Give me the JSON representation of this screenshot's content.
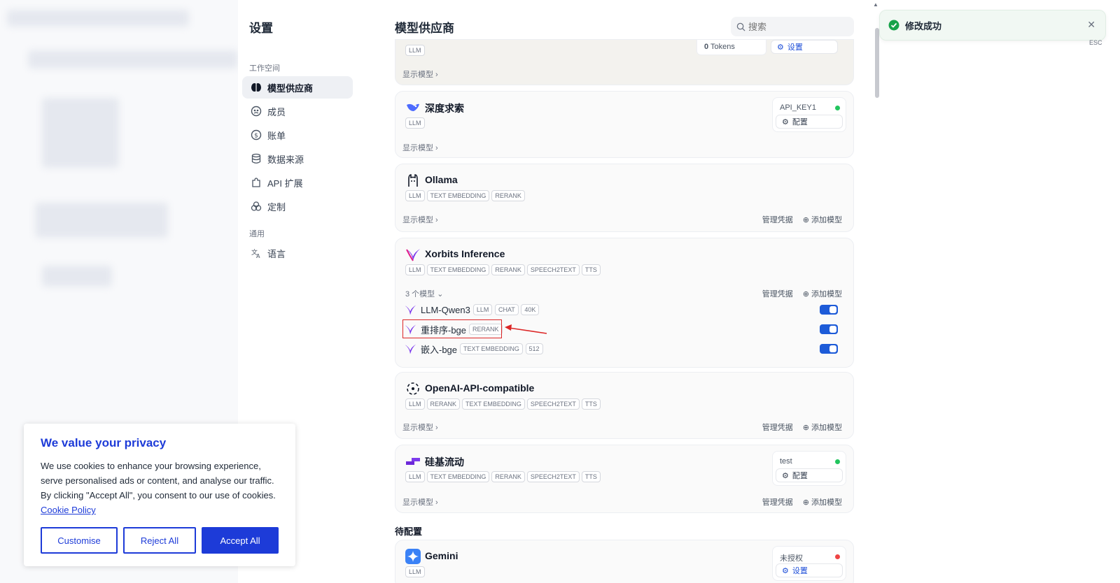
{
  "settings": {
    "title": "设置",
    "group_workspace": "工作空间",
    "group_general": "通用",
    "items": [
      {
        "label": "模型供应商",
        "icon": "brain-icon",
        "active": true
      },
      {
        "label": "成员",
        "icon": "members-icon"
      },
      {
        "label": "账单",
        "icon": "billing-icon"
      },
      {
        "label": "数据来源",
        "icon": "database-icon"
      },
      {
        "label": "API 扩展",
        "icon": "puzzle-icon"
      },
      {
        "label": "定制",
        "icon": "customize-icon"
      }
    ],
    "language": "语言"
  },
  "main": {
    "title": "模型供应商",
    "search_placeholder": "搜索",
    "show_models": "显示模型",
    "manage_credentials": "管理凭据",
    "add_model": "添加模型",
    "pending_section": "待配置",
    "top_card": {
      "tags": [
        "LLM"
      ],
      "tokens_value": "0",
      "tokens_unit": "Tokens",
      "button": "设置"
    },
    "providers": [
      {
        "name": "深度求索",
        "tags": [
          "LLM"
        ],
        "credential": "API_KEY1",
        "status_color": "#22c55e",
        "button": "配置"
      },
      {
        "name": "Ollama",
        "tags": [
          "LLM",
          "TEXT EMBEDDING",
          "RERANK"
        ]
      },
      {
        "name": "Xorbits Inference",
        "tags": [
          "LLM",
          "TEXT EMBEDDING",
          "RERANK",
          "SPEECH2TEXT",
          "TTS"
        ],
        "model_count": "3 个模型",
        "models": [
          {
            "name": "LLM-Qwen3",
            "tags": [
              "LLM",
              "CHAT",
              "40K"
            ],
            "enabled": true
          },
          {
            "name": "重排序-bge",
            "tags": [
              "RERANK"
            ],
            "enabled": true
          },
          {
            "name": "嵌入-bge",
            "tags": [
              "TEXT EMBEDDING",
              "512"
            ],
            "enabled": true
          }
        ]
      },
      {
        "name": "OpenAI-API-compatible",
        "tags": [
          "LLM",
          "RERANK",
          "TEXT EMBEDDING",
          "SPEECH2TEXT",
          "TTS"
        ]
      },
      {
        "name": "硅基流动",
        "tags": [
          "LLM",
          "TEXT EMBEDDING",
          "RERANK",
          "SPEECH2TEXT",
          "TTS"
        ],
        "credential": "test",
        "status_color": "#22c55e",
        "button": "配置"
      },
      {
        "name": "Gemini",
        "tags": [
          "LLM"
        ],
        "credential": "未授权",
        "status_color": "#ef4444",
        "button": "设置"
      }
    ]
  },
  "toast": {
    "message": "修改成功",
    "esc": "ESC"
  },
  "cookie": {
    "title": "We value your privacy",
    "body": "We use cookies to enhance your browsing experience, serve personalised ads or content, and analyse our traffic. By clicking \"Accept All\", you consent to our use of cookies.",
    "link": "Cookie Policy",
    "customise": "Customise",
    "reject": "Reject All",
    "accept": "Accept All"
  },
  "colors": {
    "accent": "#1d5bd8",
    "cookie_blue": "#1d3bd8",
    "highlight_red": "#dc2626"
  }
}
